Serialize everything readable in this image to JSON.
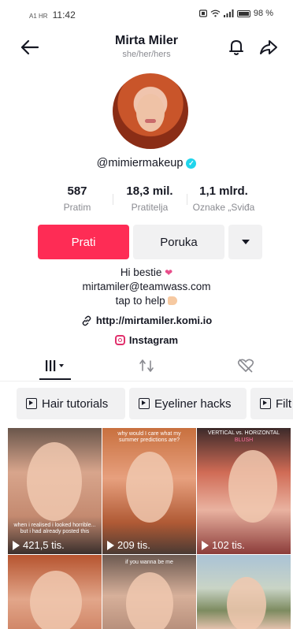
{
  "status_bar": {
    "carrier": "A1 HR",
    "time": "11:42",
    "battery": "98 %"
  },
  "header": {
    "name": "Mirta Miler",
    "pronouns": "she/her/hers"
  },
  "profile": {
    "handle": "@mimiermakeup",
    "verified": true,
    "stats": [
      {
        "value": "587",
        "label": "Pratim"
      },
      {
        "value": "18,3 mil.",
        "label": "Pratitelja"
      },
      {
        "value": "1,1 mlrd.",
        "label": "Oznake „Sviđa"
      }
    ],
    "follow_label": "Prati",
    "message_label": "Poruka",
    "bio_line1": "Hi bestie",
    "bio_line2": "mirtamiler@teamwass.com",
    "bio_line3": "tap to help",
    "link": "http://mirtamiler.komi.io",
    "instagram": "Instagram"
  },
  "tabs": [
    {
      "name": "videos",
      "icon": "grid-icon",
      "active": true
    },
    {
      "name": "reposts",
      "icon": "repost-icon",
      "active": false
    },
    {
      "name": "liked",
      "icon": "liked-hidden-icon",
      "active": false
    }
  ],
  "playlists": [
    "Hair tutorials",
    "Eyeliner hacks",
    "Filt"
  ],
  "videos": [
    {
      "views": "421,5 tis.",
      "overlay": "when i realised i looked horrible... but i had already posted this"
    },
    {
      "views": "209 tis.",
      "overlay": "why would I care what my summer predictions are?"
    },
    {
      "views": "102 tis.",
      "overlay": "VERTICAL vs. HORIZONTAL",
      "overlay2": "BLUSH"
    },
    {
      "views": "",
      "overlay": ""
    },
    {
      "views": "",
      "overlay": "if you wanna be me"
    },
    {
      "views": "",
      "overlay": ""
    }
  ],
  "colors": {
    "accent": "#fe2c55",
    "verified": "#20d5ec"
  }
}
